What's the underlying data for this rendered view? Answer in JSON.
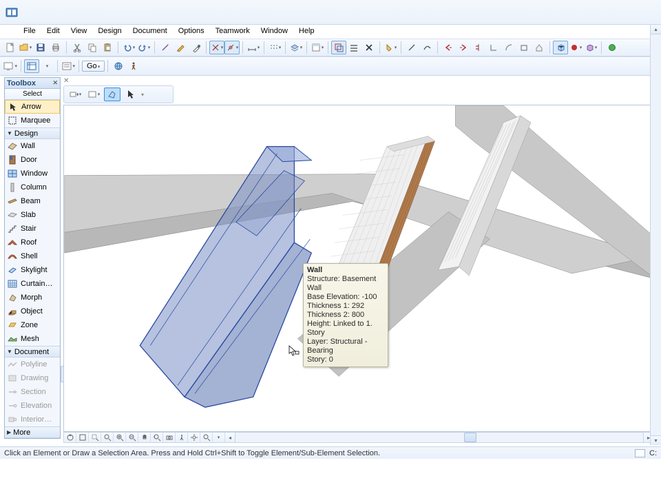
{
  "menubar": [
    "File",
    "Edit",
    "View",
    "Design",
    "Document",
    "Options",
    "Teamwork",
    "Window",
    "Help"
  ],
  "toolbox": {
    "title": "Toolbox",
    "select_label": "Select",
    "arrow": "Arrow",
    "marquee": "Marquee",
    "design_section": "Design",
    "tools": [
      "Wall",
      "Door",
      "Window",
      "Column",
      "Beam",
      "Slab",
      "Stair",
      "Roof",
      "Shell",
      "Skylight",
      "Curtain…",
      "Morph",
      "Object",
      "Zone",
      "Mesh"
    ],
    "document_section": "Document",
    "doc_tools": [
      "Polyline",
      "Drawing",
      "Section",
      "Elevation",
      "Interior…"
    ],
    "more": "More"
  },
  "go_label": "Go",
  "info": {
    "title": "Wall",
    "rows": [
      "Structure: Basement Wall",
      "Base Elevation: -100",
      "Thickness 1: 292",
      "Thickness 2: 800",
      "Height: Linked to 1. Story",
      "Layer: Structural - Bearing",
      "Story: 0"
    ]
  },
  "status": "Click an Element or Draw a Selection Area. Press and Hold Ctrl+Shift to Toggle Element/Sub-Element Selection.",
  "status_right": "C:"
}
